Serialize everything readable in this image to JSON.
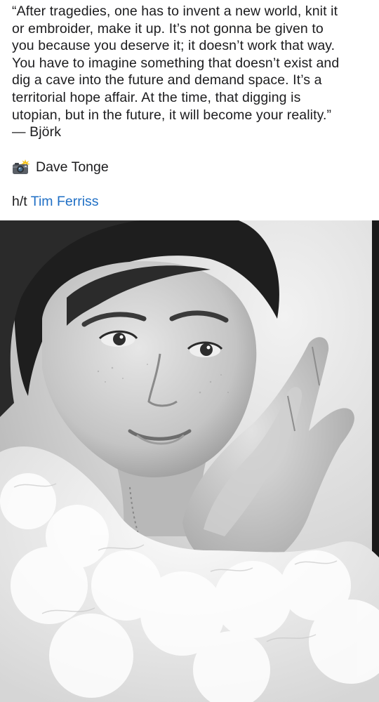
{
  "post": {
    "quote_lines": [
      "“After tragedies, one has to invent a new world, knit it",
      "or embroider, make it up. It’s not gonna be given to",
      "you because you deserve it; it doesn’t work that way.",
      "You have to imagine something that doesn’t exist and",
      "dig a cave into the future and demand space. It’s a",
      "territorial hope affair. At the time, that digging is",
      "utopian, but in the future, it will become your reality.”",
      "— Björk"
    ],
    "photo_credit_icon": "camera-flash-icon",
    "photo_credit": "Dave Tonge",
    "ht_prefix": "h/t",
    "ht_name": "Tim Ferriss",
    "link_color": "#1f6fc5"
  },
  "photo": {
    "type": "black-and-white portrait photograph"
  }
}
